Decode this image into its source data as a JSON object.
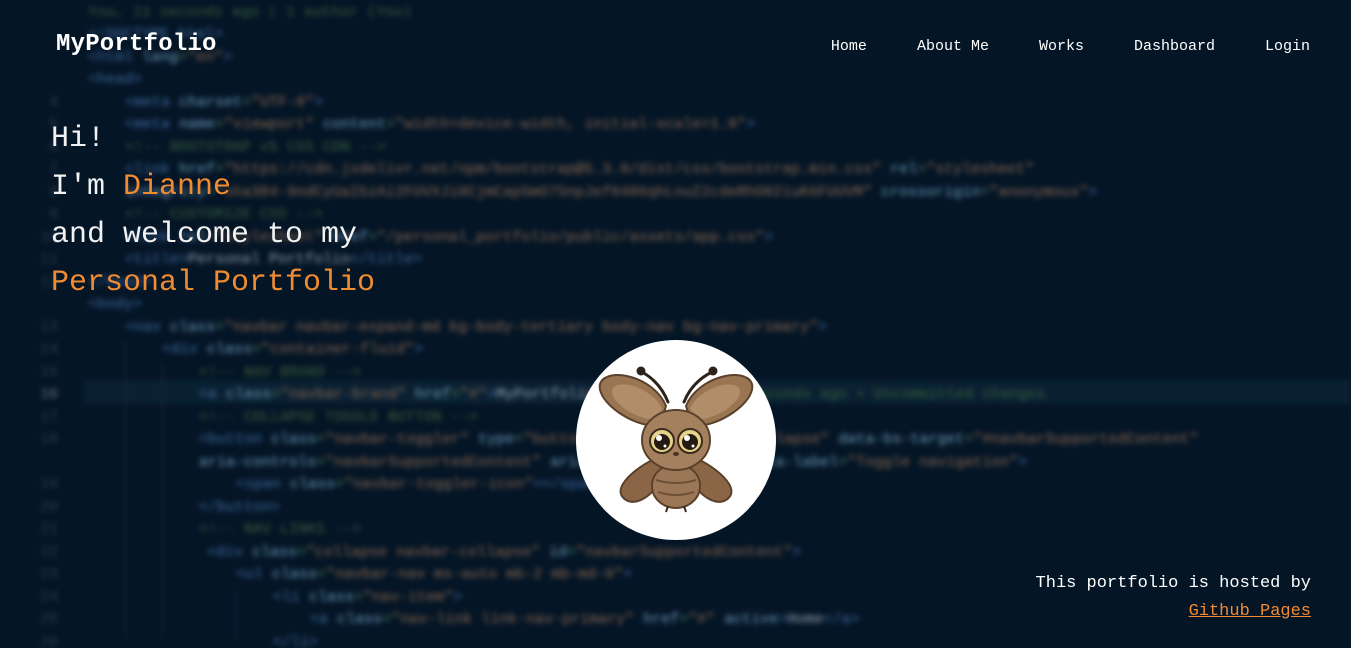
{
  "nav": {
    "brand": "MyPortfolio",
    "items": [
      {
        "label": "Home"
      },
      {
        "label": "About Me"
      },
      {
        "label": "Works"
      },
      {
        "label": "Dashboard"
      },
      {
        "label": "Login"
      }
    ]
  },
  "hero": {
    "greeting": "Hi!",
    "im": "I'm ",
    "name": "Dianne",
    "welcome": "and welcome to my",
    "portfolio": "Personal Portfolio"
  },
  "avatar": {
    "icon": "moth-mascot-icon"
  },
  "footer": {
    "hosted_text": "This portfolio is hosted by",
    "link_label": "Github Pages"
  },
  "colors": {
    "background": "#041526",
    "accent": "#f08b32",
    "text": "#ffffff"
  }
}
